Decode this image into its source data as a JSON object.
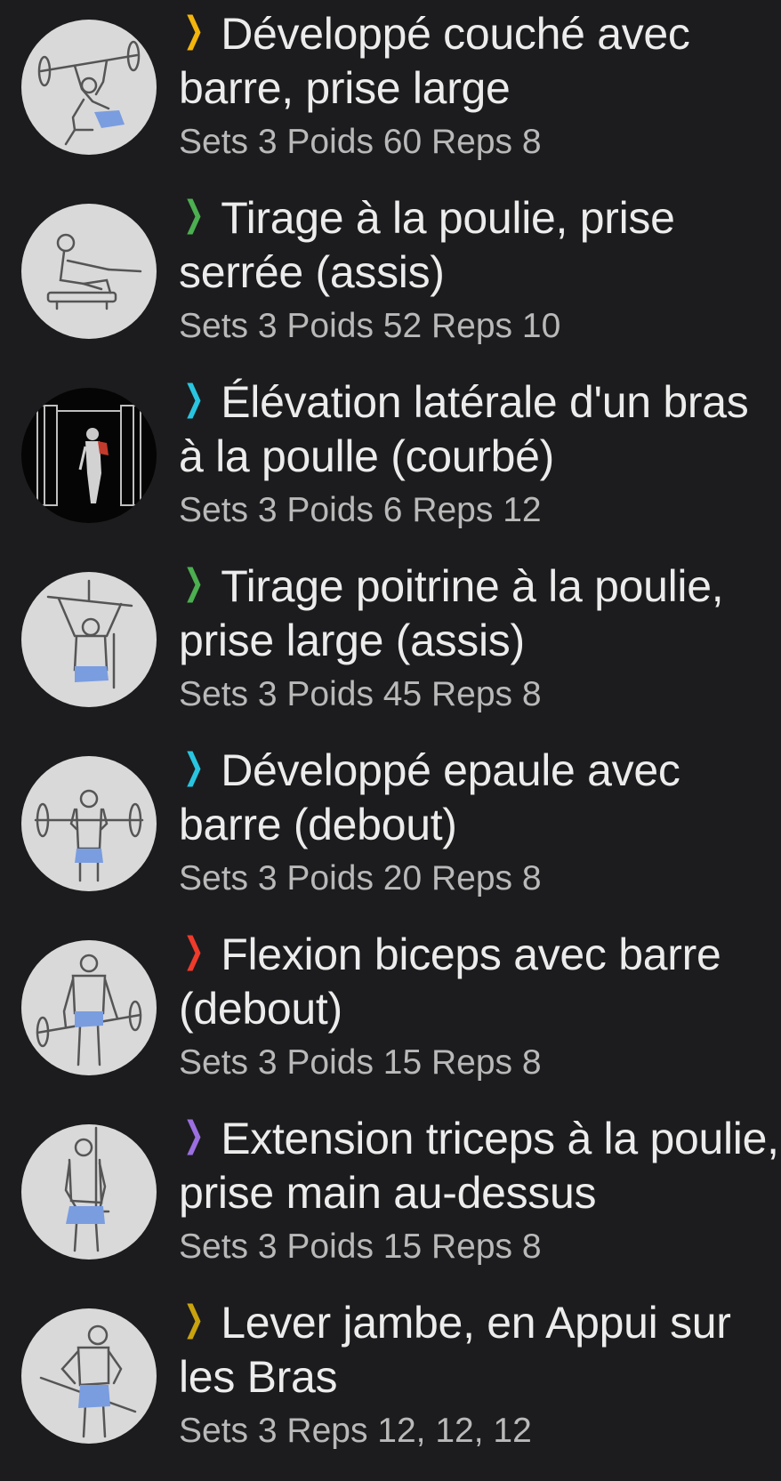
{
  "exercises": [
    {
      "title": "Développé couché avec barre, prise large",
      "details": "Sets 3 Poids 60 Reps 8",
      "chevron_color": "#f3b50c",
      "icon": "bench-press-icon"
    },
    {
      "title": "Tirage à la poulie, prise serrée (assis)",
      "details": "Sets 3 Poids 52 Reps 10",
      "chevron_color": "#4caf50",
      "icon": "seated-cable-row-icon"
    },
    {
      "title": "Élévation latérale d'un bras à la poulle (courbé)",
      "details": "Sets 3 Poids 6 Reps 12",
      "chevron_color": "#29c5e0",
      "icon": "cable-lateral-raise-icon"
    },
    {
      "title": "Tirage poitrine à la poulie, prise large (assis)",
      "details": "Sets 3 Poids 45 Reps 8",
      "chevron_color": "#4caf50",
      "icon": "lat-pulldown-icon"
    },
    {
      "title": "Développé epaule avec barre (debout)",
      "details": "Sets 3 Poids 20 Reps 8",
      "chevron_color": "#29c5e0",
      "icon": "overhead-press-icon"
    },
    {
      "title": "Flexion biceps avec barre (debout)",
      "details": "Sets 3 Poids 15 Reps 8",
      "chevron_color": "#ef3b2c",
      "icon": "barbell-curl-icon"
    },
    {
      "title": "Extension triceps à la poulie, prise main au-dessus",
      "details": "Sets 3 Poids 15 Reps 8",
      "chevron_color": "#9c6fe0",
      "icon": "triceps-pushdown-icon"
    },
    {
      "title": "Lever jambe, en Appui sur les Bras",
      "details": "Sets 3 Reps 12, 12, 12",
      "chevron_color": "#c9a30e",
      "icon": "leg-raise-icon"
    }
  ],
  "chevron_glyph": "❯"
}
